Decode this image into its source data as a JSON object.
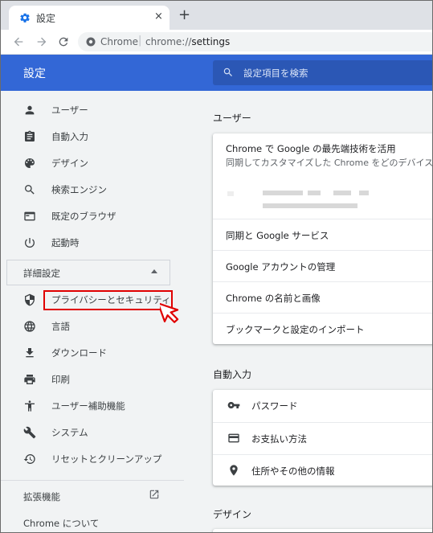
{
  "browser": {
    "tab_title": "設定",
    "tab_close": "×",
    "new_tab": "+",
    "omnibox_site": "Chrome",
    "omnibox_sep": "|",
    "omnibox_scheme": "chrome://",
    "omnibox_path": "settings"
  },
  "header": {
    "title": "設定",
    "search_placeholder": "設定項目を検索"
  },
  "sidebar": {
    "items": [
      {
        "label": "ユーザー",
        "icon": "person-icon"
      },
      {
        "label": "自動入力",
        "icon": "clipboard-icon"
      },
      {
        "label": "デザイン",
        "icon": "palette-icon"
      },
      {
        "label": "検索エンジン",
        "icon": "search-icon"
      },
      {
        "label": "既定のブラウザ",
        "icon": "browser-window-icon"
      },
      {
        "label": "起動時",
        "icon": "power-icon"
      }
    ],
    "advanced_label": "詳細設定",
    "advanced_items": [
      {
        "label": "プライバシーとセキュリティ",
        "icon": "shield-icon"
      },
      {
        "label": "言語",
        "icon": "globe-icon"
      },
      {
        "label": "ダウンロード",
        "icon": "download-icon"
      },
      {
        "label": "印刷",
        "icon": "printer-icon"
      },
      {
        "label": "ユーザー補助機能",
        "icon": "accessibility-icon"
      },
      {
        "label": "システム",
        "icon": "wrench-icon"
      },
      {
        "label": "リセットとクリーンアップ",
        "icon": "restore-icon"
      }
    ],
    "extensions_label": "拡張機能",
    "about_label": "Chrome について"
  },
  "main": {
    "users_section": "ユーザー",
    "sync_promo_title": "Chrome で Google の最先端技術を活用",
    "sync_promo_desc": "同期してカスタマイズした Chrome をどのデバイスで",
    "user_rows": [
      "同期と Google サービス",
      "Google アカウントの管理",
      "Chrome の名前と画像",
      "ブックマークと設定のインポート"
    ],
    "autofill_section": "自動入力",
    "autofill_rows": [
      {
        "label": "パスワード",
        "icon": "key-icon"
      },
      {
        "label": "お支払い方法",
        "icon": "credit-card-icon"
      },
      {
        "label": "住所やその他の情報",
        "icon": "location-pin-icon"
      }
    ],
    "design_section": "デザイン"
  },
  "colors": {
    "header_blue": "#3367d6",
    "highlight_red": "#e00000"
  }
}
